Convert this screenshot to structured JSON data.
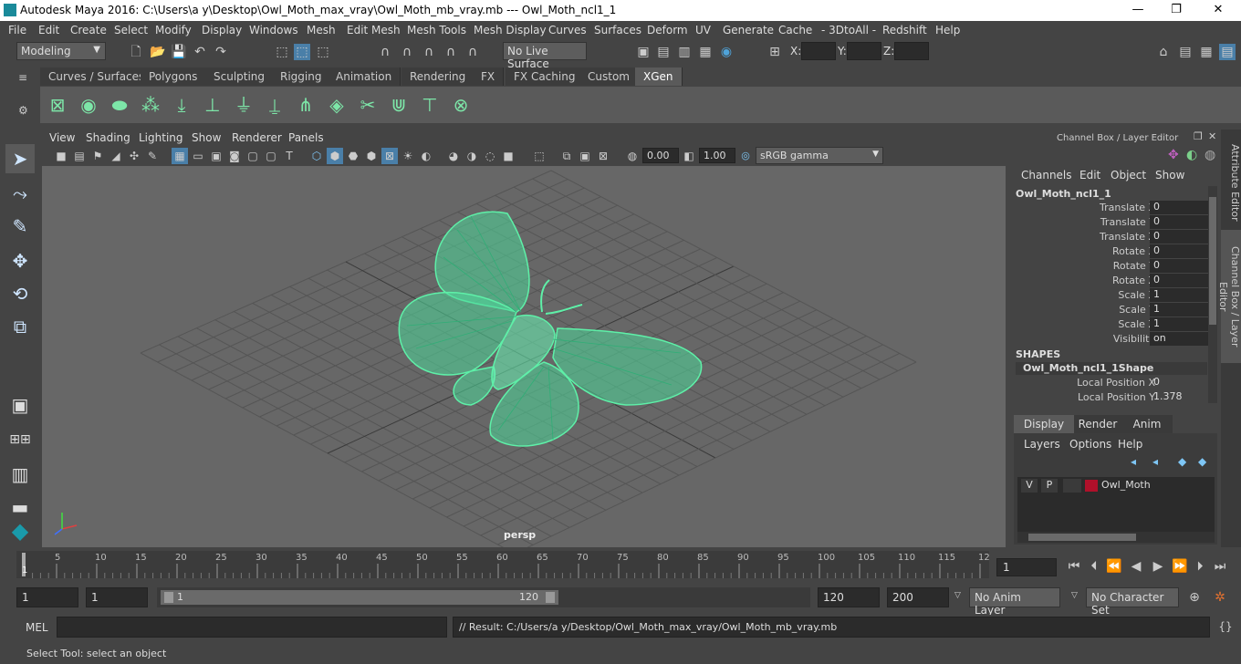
{
  "title": "Autodesk Maya 2016: C:\\Users\\a y\\Desktop\\Owl_Moth_max_vray\\Owl_Moth_mb_vray.mb   ---   Owl_Moth_ncl1_1",
  "window_buttons": {
    "minimize": "—",
    "restore": "❐",
    "close": "✕"
  },
  "menubar": [
    "File",
    "Edit",
    "Create",
    "Select",
    "Modify",
    "Display",
    "Windows",
    "Mesh",
    "Edit Mesh",
    "Mesh Tools",
    "Mesh Display",
    "Curves",
    "Surfaces",
    "Deform",
    "UV",
    "Generate",
    "Cache",
    "- 3DtoAll -",
    "Redshift",
    "Help"
  ],
  "status": {
    "mode": "Modeling",
    "live_surface": "No Live Surface",
    "x_label": "X:",
    "y_label": "Y:",
    "z_label": "Z:"
  },
  "shelf_tabs": [
    "Curves / Surfaces",
    "Polygons",
    "Sculpting",
    "Rigging",
    "Animation",
    "Rendering",
    "FX",
    "FX Caching",
    "Custom",
    "XGen"
  ],
  "active_shelf_tab": "XGen",
  "viewport": {
    "menu": [
      "View",
      "Shading",
      "Lighting",
      "Show",
      "Renderer",
      "Panels"
    ],
    "exposure": "0.00",
    "gamma": "1.00",
    "color_space": "sRGB gamma",
    "camera_label": "persp"
  },
  "channel_box": {
    "header": "Channel Box / Layer Editor",
    "menu": [
      "Channels",
      "Edit",
      "Object",
      "Show"
    ],
    "object_name": "Owl_Moth_ncl1_1",
    "attributes": [
      {
        "label": "Translate X",
        "value": "0"
      },
      {
        "label": "Translate Y",
        "value": "0"
      },
      {
        "label": "Translate Z",
        "value": "0"
      },
      {
        "label": "Rotate X",
        "value": "0"
      },
      {
        "label": "Rotate Y",
        "value": "0"
      },
      {
        "label": "Rotate Z",
        "value": "0"
      },
      {
        "label": "Scale X",
        "value": "1"
      },
      {
        "label": "Scale Y",
        "value": "1"
      },
      {
        "label": "Scale Z",
        "value": "1"
      },
      {
        "label": "Visibility",
        "value": "on"
      }
    ],
    "shapes_header": "SHAPES",
    "shape_name": "Owl_Moth_ncl1_1Shape",
    "shape_attributes": [
      {
        "label": "Local Position X",
        "value": "0"
      },
      {
        "label": "Local Position Y",
        "value": "1.378"
      }
    ]
  },
  "layer_editor": {
    "tabs": [
      "Display",
      "Render",
      "Anim"
    ],
    "active_tab": "Display",
    "menu": [
      "Layers",
      "Options",
      "Help"
    ],
    "layers": [
      {
        "v": "V",
        "p": "P",
        "name": "Owl_Moth",
        "color": "#b0102a"
      }
    ]
  },
  "side_tabs": [
    "Attribute Editor",
    "Channel Box / Layer Editor"
  ],
  "timeline": {
    "ticks": [
      "5",
      "10",
      "15",
      "20",
      "25",
      "30",
      "35",
      "40",
      "45",
      "50",
      "55",
      "60",
      "65",
      "70",
      "75",
      "80",
      "85",
      "90",
      "95",
      "100",
      "105",
      "110",
      "115",
      "12"
    ],
    "current_frame_marker": "1",
    "current_frame": "1"
  },
  "range": {
    "start": "1",
    "playback_start": "1",
    "slider_start": "1",
    "slider_end": "120",
    "playback_end": "120",
    "end": "200",
    "anim_layer": "No Anim Layer",
    "character_set": "No Character Set"
  },
  "command": {
    "mel_label": "MEL",
    "result": "// Result: C:/Users/a y/Desktop/Owl_Moth_max_vray/Owl_Moth_mb_vray.mb"
  },
  "help_line": "Select Tool: select an object",
  "colors": {
    "wireframe": "#5ef0a8",
    "viewport_bg": "#676767",
    "accent": "#4fa3d9"
  }
}
